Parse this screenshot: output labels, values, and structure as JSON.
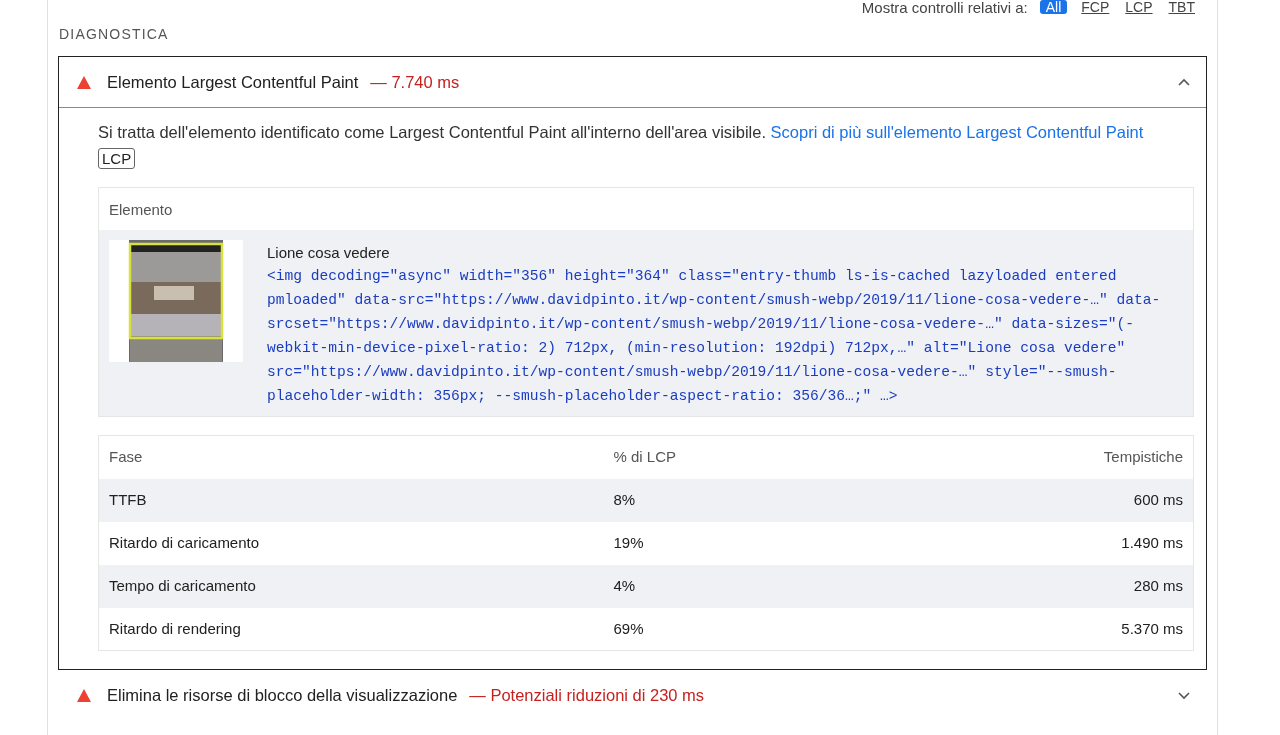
{
  "filter": {
    "label": "Mostra controlli relativi a:",
    "options": [
      {
        "label": "All",
        "selected": true
      },
      {
        "label": "FCP",
        "selected": false
      },
      {
        "label": "LCP",
        "selected": false
      },
      {
        "label": "TBT",
        "selected": false
      }
    ]
  },
  "section_title": "DIAGNOSTICA",
  "audits": [
    {
      "title": "Elemento Largest Contentful Paint",
      "value": "— 7.740 ms",
      "expanded": true,
      "description": "Si tratta dell'elemento identificato come Largest Contentful Paint all'interno dell'area visibile.",
      "link": "Scopri di più sull'elemento Largest Contentful Paint",
      "tags": [
        "LCP"
      ],
      "element_table": {
        "header": "Elemento",
        "node_label": "Lione cosa vedere",
        "snippet": "<img decoding=\"async\" width=\"356\" height=\"364\" class=\"entry-thumb ls-is-cached lazyloaded entered pmloaded\" data-src=\"https://www.davidpinto.it/wp-content/smush-webp/2019/11/lione-cosa-vedere-…\" data-srcset=\"https://www.davidpinto.it/wp-content/smush-webp/2019/11/lione-cosa-vedere-…\" data-sizes=\"(-webkit-min-device-pixel-ratio: 2) 712px, (min-resolution: 192dpi) 712px,…\" alt=\"Lione cosa vedere\" src=\"https://www.davidpinto.it/wp-content/smush-webp/2019/11/lione-cosa-vedere-…\" style=\"--smush-placeholder-width: 356px; --smush-placeholder-aspect-ratio: 356/36…;\" …>"
      },
      "phase_table": {
        "columns": [
          "Fase",
          "% di LCP",
          "Tempistiche"
        ],
        "rows": [
          [
            "TTFB",
            "8%",
            "600 ms"
          ],
          [
            "Ritardo di caricamento",
            "19%",
            "1.490 ms"
          ],
          [
            "Tempo di caricamento",
            "4%",
            "280 ms"
          ],
          [
            "Ritardo di rendering",
            "69%",
            "5.370 ms"
          ]
        ]
      }
    },
    {
      "title": "Elimina le risorse di blocco della visualizzazione",
      "value": "— Potenziali riduzioni di 230 ms",
      "expanded": false
    }
  ]
}
